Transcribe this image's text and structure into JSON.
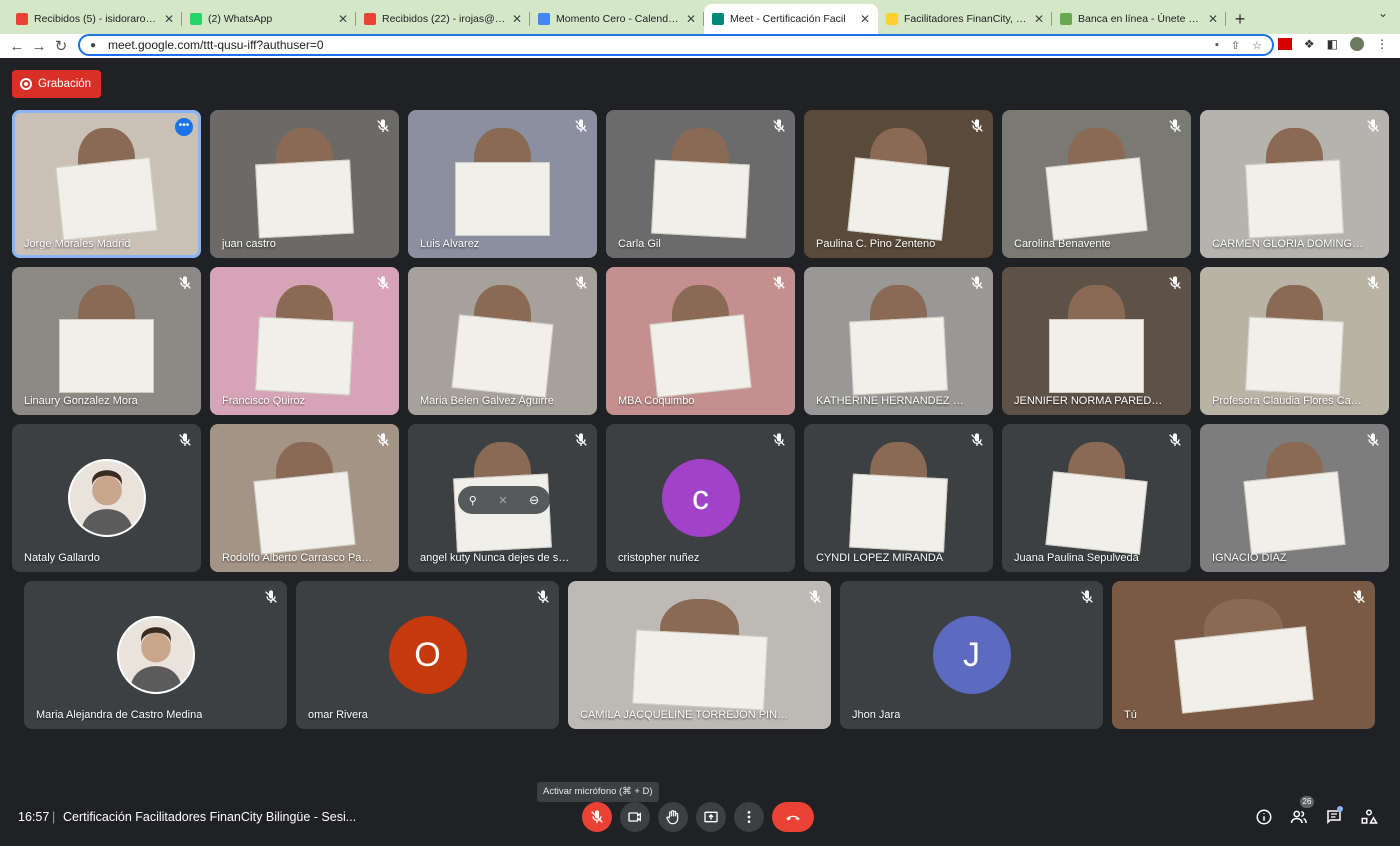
{
  "tabs": [
    {
      "title": "Recibidos (5) - isidorarojas@g",
      "icon": "gmail-icon",
      "color": "#ea4335"
    },
    {
      "title": "(2) WhatsApp",
      "icon": "whatsapp-icon",
      "color": "#25d366"
    },
    {
      "title": "Recibidos (22) - irojas@mome",
      "icon": "gmail-icon",
      "color": "#ea4335"
    },
    {
      "title": "Momento Cero - Calendar - Se",
      "icon": "calendar-icon",
      "color": "#4285f4"
    },
    {
      "title": "Meet - Certificación Facil",
      "icon": "meet-icon",
      "color": "#00897b",
      "active": true
    },
    {
      "title": "Facilitadores FinanCity, Online",
      "icon": "miro-icon",
      "color": "#ffd02f"
    },
    {
      "title": "Banca en línea - Únete a los G",
      "icon": "bank-icon",
      "color": "#6aa84f"
    }
  ],
  "address": {
    "url": "meet.google.com/ttt-qusu-iff?authuser=0"
  },
  "recording": {
    "label": "Grabación"
  },
  "participants": [
    {
      "name": "Jorge Morales Madrid",
      "selected": true,
      "bg": "#c9c1b6"
    },
    {
      "name": "juan castro",
      "bg": "#6b6a66"
    },
    {
      "name": "Luis Alvarez",
      "bg": "#8b8fa0"
    },
    {
      "name": "Carla Gil",
      "bg": "#6b6b6b"
    },
    {
      "name": "Paulina C. Pino Zenteno",
      "bg": "#5a4a3a"
    },
    {
      "name": "Carolina Benavente",
      "bg": "#7a7a72"
    },
    {
      "name": "CARMEN GLORIA DOMINGUEZ",
      "bg": "#b5b3ad"
    },
    {
      "name": "Linaury Gonzalez Mora",
      "bg": "#8d8a86"
    },
    {
      "name": "Francisco Quiroz",
      "bg": "#d7a4b7"
    },
    {
      "name": "Maria Belen Galvez Aguirre",
      "bg": "#a6a19a"
    },
    {
      "name": "MBA Coquimbo",
      "bg": "#c48f8e"
    },
    {
      "name": "KATHERINE HERNANDEZ CASTIL...",
      "bg": "#9a9896"
    },
    {
      "name": "JENNIFER NORMA PAREDES GO...",
      "bg": "#5d5148"
    },
    {
      "name": "Profesora Claudia Flores Cangana",
      "bg": "#b9b3a6"
    },
    {
      "name": "Nataly Gallardo",
      "bg": "#3c4043",
      "avatarPhoto": true
    },
    {
      "name": "Rodolfo Alberto Carrasco Palaci...",
      "bg": "#a39486"
    },
    {
      "name": "angel kuty Nunca dejes de soñar",
      "bg": "#3c4043"
    },
    {
      "name": "cristopher nuñez",
      "bg": "#3c4043",
      "initial": "c",
      "initialColor": "#a142c9"
    },
    {
      "name": "CYNDI LOPEZ MIRANDA",
      "bg": "#3c4043"
    },
    {
      "name": "Juana Paulina Sepulveda",
      "bg": "#3c4043"
    },
    {
      "name": "IGNACIO DIAZ",
      "bg": "#7d7d7d"
    },
    {
      "name": "Maria Alejandra de Castro Medina",
      "bg": "#3c4043",
      "avatarPhoto": true
    },
    {
      "name": "omar Rivera",
      "bg": "#3c4043",
      "initial": "O",
      "initialColor": "#c53a0c"
    },
    {
      "name": "CAMILA JACQUELINE TORREJON PINTO",
      "bg": "#bdbab5"
    },
    {
      "name": "Jhon Jara",
      "bg": "#3c4043",
      "initial": "J",
      "initialColor": "#5c6bc0"
    },
    {
      "name": "Tú",
      "bg": "#7a5a44"
    }
  ],
  "bottom": {
    "time": "16:57",
    "separator": "|",
    "meeting_title": "Certificación Facilitadores FinanCity Bilingüe - Sesi...",
    "tooltip": "Activar micrófono (⌘ + D)",
    "participant_count": "26"
  },
  "colors": {
    "accent": "#1a73e8",
    "danger": "#ea4335",
    "tile": "#3c4043",
    "background": "#202124"
  }
}
